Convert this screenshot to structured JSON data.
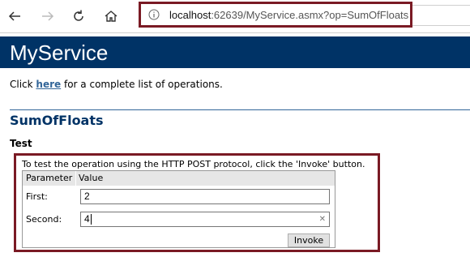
{
  "browser": {
    "url_host": "localhost",
    "url_rest": ":62639/MyService.asmx?op=SumOfFloats",
    "icons": [
      "back-arrow-icon",
      "forward-arrow-icon",
      "refresh-icon",
      "home-icon",
      "info-icon"
    ]
  },
  "page": {
    "service_name": "MyService",
    "intro_prefix": "Click ",
    "intro_link": "here",
    "intro_suffix": " for a complete list of operations.",
    "operation_name": "SumOfFloats",
    "test_heading": "Test",
    "instructions": "To test the operation using the HTTP POST protocol, click the 'Invoke' button.",
    "table": {
      "header_parameter": "Parameter",
      "header_value": "Value",
      "rows": [
        {
          "label": "First:",
          "value": "2"
        },
        {
          "label": "Second:",
          "value": "4"
        }
      ]
    },
    "invoke_label": "Invoke"
  },
  "colors": {
    "banner": "#003366",
    "highlight": "#7a1a24",
    "link": "#336699"
  }
}
